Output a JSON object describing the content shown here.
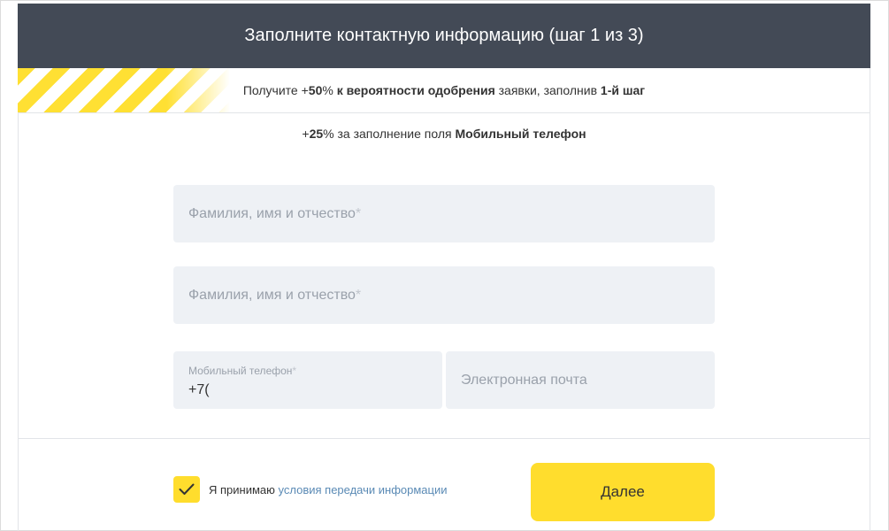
{
  "header": {
    "title": "Заполните контактную информацию (шаг 1 из 3)"
  },
  "promo": {
    "prefix": "Получите +",
    "percent": "50",
    "percent_suffix": "% ",
    "emphasis": "к вероятности одобрения",
    "middle": " заявки, заполнив ",
    "step": "1-й шаг"
  },
  "hint": {
    "prefix": "+",
    "percent": "25",
    "middle": "% за заполнение поля ",
    "field": "Мобильный телефон"
  },
  "form": {
    "name_field_1": {
      "placeholder": "Фамилия, имя и отчество",
      "required_mark": "*",
      "value": ""
    },
    "name_field_2": {
      "placeholder": "Фамилия, имя и отчество",
      "required_mark": "*",
      "value": ""
    },
    "phone_field": {
      "label": "Мобильный телефон",
      "required_mark": "*",
      "value": "+7("
    },
    "email_field": {
      "placeholder": "Электронная почта",
      "value": ""
    }
  },
  "consent": {
    "checked": true,
    "text": "Я принимаю ",
    "link": "условия передачи информации"
  },
  "actions": {
    "next_label": "Далее"
  },
  "colors": {
    "header_bg": "#434a56",
    "accent_yellow": "#ffdd2d",
    "field_bg": "#eef1f5",
    "link": "#5a8ab5",
    "placeholder": "#9aa1ab"
  },
  "icons": {
    "checkbox": "checkmark-icon"
  }
}
